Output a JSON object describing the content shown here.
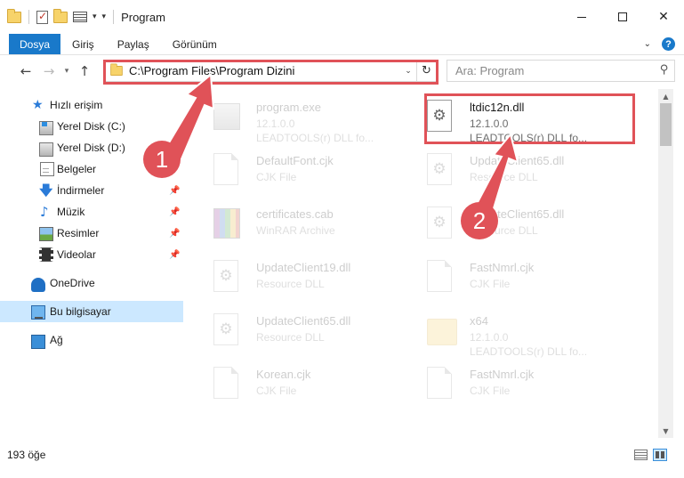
{
  "window": {
    "title": "Program"
  },
  "ribbon": {
    "tabs": [
      "Dosya",
      "Giriş",
      "Paylaş",
      "Görünüm"
    ]
  },
  "address": {
    "path": "C:\\Program Files\\Program Dizini"
  },
  "search": {
    "placeholder": "Ara: Program"
  },
  "sidebar": {
    "items": [
      {
        "label": "Hızlı erişim",
        "icon": "star-icon"
      },
      {
        "label": "Yerel Disk (C:)",
        "icon": "drive-c-icon"
      },
      {
        "label": "Yerel Disk (D:)",
        "icon": "drive-d-icon"
      },
      {
        "label": "Belgeler",
        "icon": "documents-icon"
      },
      {
        "label": "İndirmeler",
        "icon": "downloads-icon"
      },
      {
        "label": "Müzik",
        "icon": "music-icon"
      },
      {
        "label": "Resimler",
        "icon": "pictures-icon"
      },
      {
        "label": "Videolar",
        "icon": "videos-icon"
      },
      {
        "label": "OneDrive",
        "icon": "onedrive-icon"
      },
      {
        "label": "Bu bilgisayar",
        "icon": "computer-icon"
      },
      {
        "label": "Ağ",
        "icon": "network-icon"
      }
    ]
  },
  "files": [
    {
      "name": "program.exe",
      "line2": "12.1.0.0",
      "line3": "LEADTOOLS(r) DLL fo...",
      "icon": "exe-icon",
      "faded": true
    },
    {
      "name": "ltdic12n.dll",
      "line2": "12.1.0.0",
      "line3": "LEADTOOLS(r) DLL fo...",
      "icon": "dll-gear-icon",
      "faded": false
    },
    {
      "name": "DefaultFont.cjk",
      "line2": "CJK File",
      "line3": "",
      "icon": "blank-file-icon",
      "faded": true
    },
    {
      "name": "UpdateClient65.dll",
      "line2": "Resource DLL",
      "line3": "",
      "icon": "dll-gear-icon",
      "faded": true
    },
    {
      "name": "certificates.cab",
      "line2": "WinRAR Archive",
      "line3": "",
      "icon": "rar-icon",
      "faded": true
    },
    {
      "name": "UpdateClient65.dll",
      "line2": "Resource DLL",
      "line3": "",
      "icon": "dll-gear-icon",
      "faded": true
    },
    {
      "name": "UpdateClient19.dll",
      "line2": "Resource DLL",
      "line3": "",
      "icon": "dll-gear-icon",
      "faded": true
    },
    {
      "name": "FastNmrl.cjk",
      "line2": "CJK File",
      "line3": "",
      "icon": "blank-file-icon",
      "faded": true
    },
    {
      "name": "UpdateClient65.dll",
      "line2": "Resource DLL",
      "line3": "",
      "icon": "dll-gear-icon",
      "faded": true
    },
    {
      "name": "x64",
      "line2": "12.1.0.0",
      "line3": "LEADTOOLS(r) DLL fo...",
      "icon": "folder-icon",
      "faded": true
    },
    {
      "name": "Korean.cjk",
      "line2": "CJK File",
      "line3": "",
      "icon": "blank-file-icon",
      "faded": true
    },
    {
      "name": "FastNmrl.cjk",
      "line2": "CJK File",
      "line3": "",
      "icon": "blank-file-icon",
      "faded": true
    }
  ],
  "callouts": [
    "1",
    "2"
  ],
  "status": {
    "count": "193 öğe"
  },
  "colors": {
    "accent": "#1979ca",
    "highlight": "#e05258",
    "selection": "#cce8ff"
  }
}
